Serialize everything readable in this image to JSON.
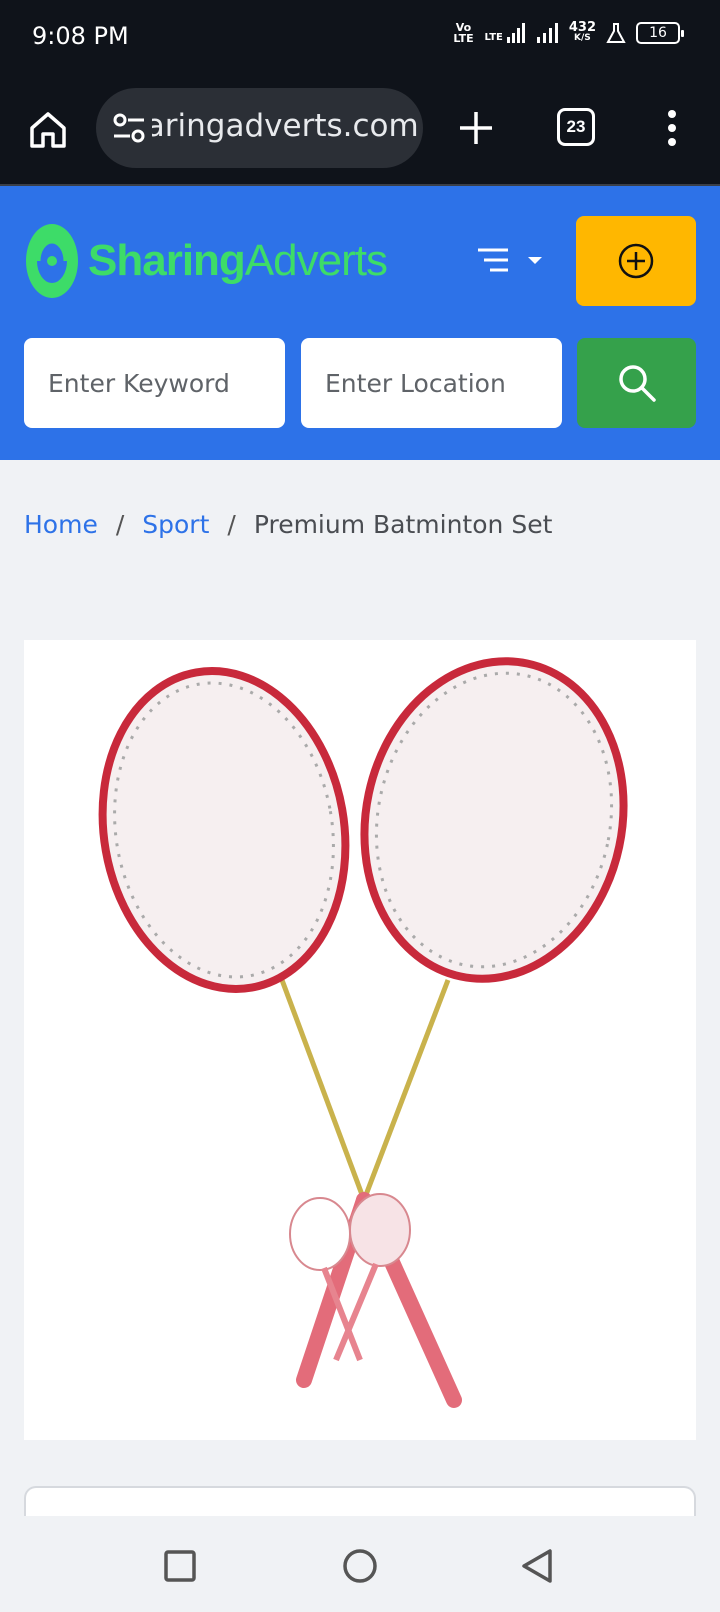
{
  "status": {
    "time": "9:08 PM",
    "volte": "Vo LTE",
    "lte": "LTE",
    "speed_value": "432",
    "speed_unit": "K/S",
    "battery": "16"
  },
  "browser": {
    "url": "sharingadverts.com",
    "tab_count": "23",
    "icons": [
      "home-icon",
      "tune-icon",
      "plus-icon",
      "tabs-icon",
      "more-vert-icon"
    ]
  },
  "header": {
    "logo_part1": "Sharing",
    "logo_part2": "Adverts",
    "keyword_placeholder": "Enter Keyword",
    "location_placeholder": "Enter Location",
    "accent_blue": "#2d72e8",
    "post_button_color": "#ffb700",
    "search_button_color": "#35a14b"
  },
  "breadcrumb": {
    "home": "Home",
    "separator": "/",
    "category": "Sport",
    "current": "Premium Batminton Set"
  },
  "product": {
    "image_alt": "badminton-rackets-photo"
  },
  "navbar": {
    "icons": [
      "recents-square-icon",
      "home-circle-icon",
      "back-triangle-icon"
    ]
  }
}
